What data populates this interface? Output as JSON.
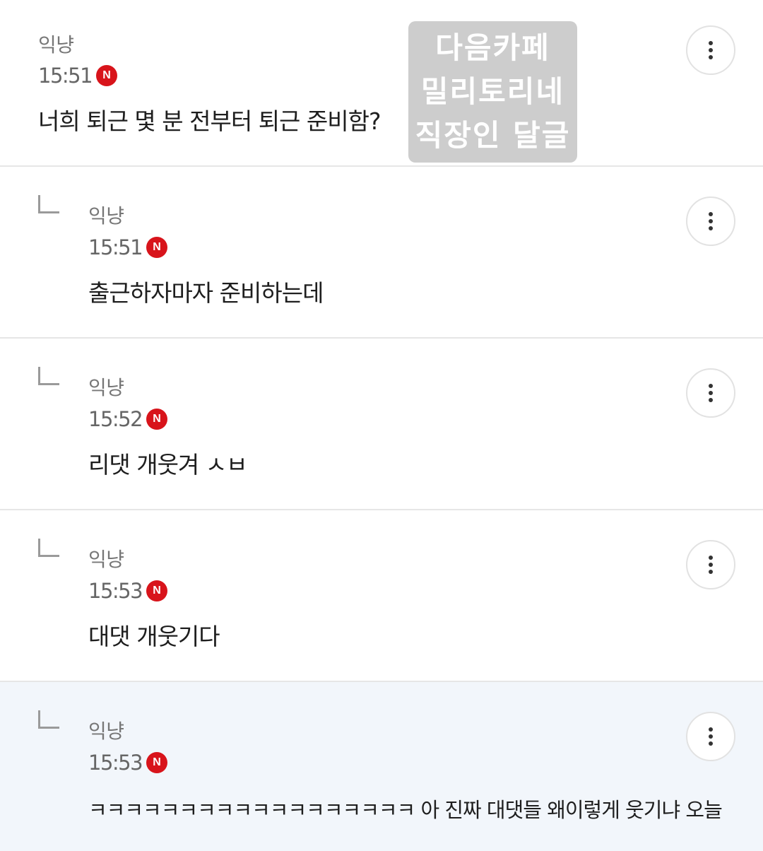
{
  "comments": [
    {
      "author": "익냥",
      "time": "15:51",
      "badge": "N",
      "text": "너희 퇴근 몇 분 전부터 퇴근 준비함?",
      "is_reply": false
    },
    {
      "author": "익냥",
      "time": "15:51",
      "badge": "N",
      "text": "출근하자마자 준비하는데",
      "is_reply": true
    },
    {
      "author": "익냥",
      "time": "15:52",
      "badge": "N",
      "text": "리댓 개웃겨 ㅅㅂ",
      "is_reply": true
    },
    {
      "author": "익냥",
      "time": "15:53",
      "badge": "N",
      "text": "대댓 개웃기다",
      "is_reply": true
    },
    {
      "author": "익냥",
      "time": "15:53",
      "badge": "N",
      "text": "ㅋㅋㅋㅋㅋㅋㅋㅋㅋㅋㅋㅋㅋㅋㅋㅋㅋㅋ 아 진짜 대댓들 왜이렇게 웃기냐 오늘",
      "is_reply": true,
      "highlighted": true
    }
  ],
  "watermark": {
    "line1": "다음카페",
    "line2": "밀리토리네",
    "line3": "직장인 달글"
  },
  "icons": {
    "more": "more-vertical-icon",
    "reply": "reply-arrow-icon",
    "new": "new-badge"
  },
  "colors": {
    "badge": "#d8141b",
    "highlight_bg": "#f2f6fb",
    "divider": "#e6e6e6"
  }
}
